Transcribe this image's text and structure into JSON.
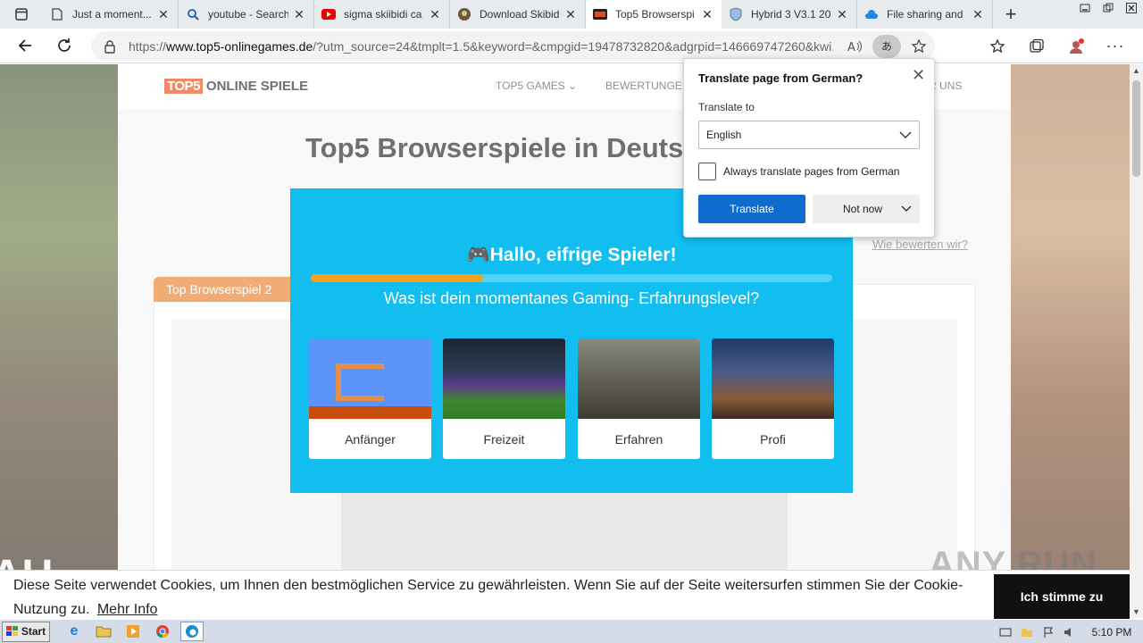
{
  "browser": {
    "tabs": [
      {
        "title": "Just a moment...",
        "icon": "page-icon",
        "active": false
      },
      {
        "title": "youtube - Search",
        "icon": "search-icon",
        "active": false
      },
      {
        "title": "sigma skiibidi ca",
        "icon": "youtube-icon",
        "active": false
      },
      {
        "title": "Download Skibid",
        "icon": "site-icon",
        "active": false
      },
      {
        "title": "Top5 Browserspi",
        "icon": "top5-icon",
        "active": true
      },
      {
        "title": "Hybrid 3 V3.1 20",
        "icon": "shield-icon",
        "active": false
      },
      {
        "title": "File sharing and",
        "icon": "cloud-icon",
        "active": false
      }
    ],
    "url_prefix": "https://",
    "url_host": "www.top5-onlinegames.de",
    "url_rest": "/?utm_source=24&tmplt=1.5&keyword=&cmpgid=19478732820&adgrpid=146669747260&kwi..."
  },
  "site": {
    "logo_badge": "TOP5",
    "logo_text": "ONLINE SPIELE",
    "nav": [
      "TOP5 GAMES",
      "BEWERTUNGE",
      "R UNS"
    ],
    "title": "Top5 Browserspiele in Deutsc",
    "how_link": "Wie bewerten wir?",
    "card_tab": "Top Browserspiel 2",
    "side_text": "AU"
  },
  "quiz": {
    "title": "🎮Hallo, eifrige Spieler!",
    "question": "Was ist dein momentanes Gaming- Erfahrungslevel?",
    "progress": 0.33,
    "options": [
      {
        "label": "Anfänger"
      },
      {
        "label": "Freizeit"
      },
      {
        "label": "Erfahren"
      },
      {
        "label": "Profi"
      }
    ]
  },
  "translate": {
    "title": "Translate page from German?",
    "label": "Translate to",
    "language": "English",
    "checkbox": "Always translate pages from German",
    "translate_btn": "Translate",
    "notnow_btn": "Not now"
  },
  "cookie": {
    "text": "Diese Seite verwendet Cookies, um Ihnen den bestmöglichen Service zu gewährleisten. Wenn Sie auf der Seite weitersurfen stimmen Sie der Cookie-Nutzung zu.",
    "more": "Mehr Info",
    "accept": "Ich stimme zu"
  },
  "watermark": "ANY RUN",
  "taskbar": {
    "start": "Start",
    "clock": "5:10 PM"
  },
  "colors": {
    "accent_orange": "#e8802a",
    "modal_blue": "#12bdf0",
    "edge_blue": "#0f6cce"
  }
}
